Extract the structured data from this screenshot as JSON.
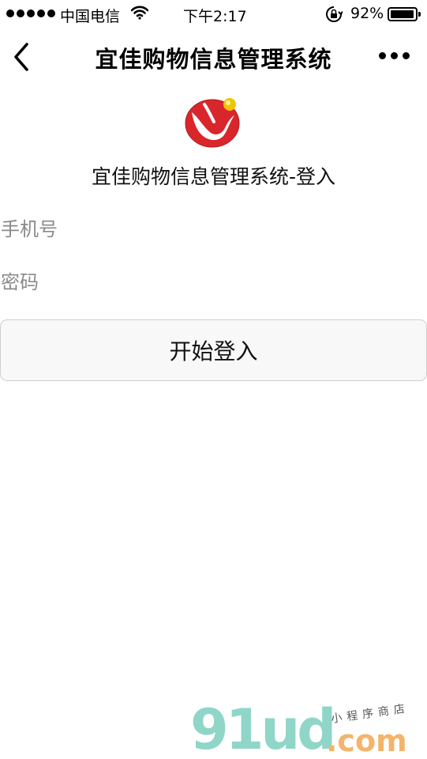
{
  "status_bar": {
    "carrier": "中国电信",
    "time": "下午2:17",
    "battery_percent": "92%",
    "battery_level": 0.92,
    "icons": [
      "signal-dots-icon",
      "wifi-icon",
      "rotation-lock-icon",
      "battery-icon"
    ]
  },
  "nav": {
    "title": "宜佳购物信息管理系统",
    "back_icon": "chevron-left-icon",
    "more_icon": "more-dots-icon"
  },
  "header": {
    "logo_icon": "brand-logo-icon",
    "title": "宜佳购物信息管理系统-登入"
  },
  "form": {
    "phone_placeholder": "手机号",
    "password_placeholder": "密码",
    "submit_label": "开始登入"
  },
  "watermark": {
    "brand": "91ud",
    "suffix": ".com",
    "subtitle": "小程序商店"
  },
  "colors": {
    "logo_red": "#d9262c",
    "logo_gold": "#f1c400",
    "watermark_teal": "#8fd6c8",
    "watermark_orange": "#f4b46a"
  }
}
